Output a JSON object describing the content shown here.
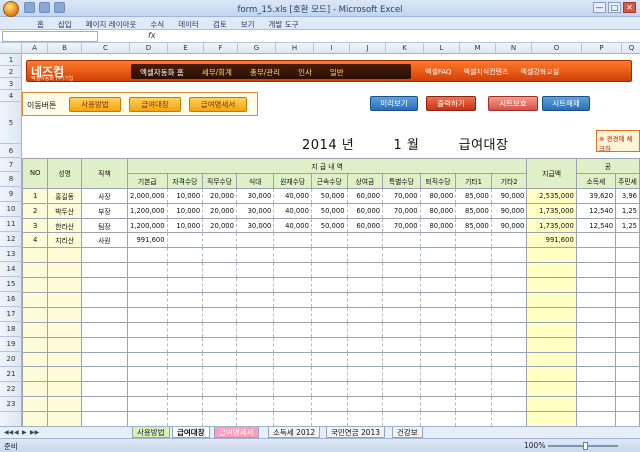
{
  "window": {
    "title": "form_15.xls [호환 모드] - Microsoft Excel",
    "controls": [
      "—",
      "□",
      "✕"
    ]
  },
  "ribbon": {
    "tabs": [
      "홈",
      "삽입",
      "페이지 레이아웃",
      "수식",
      "데이터",
      "검토",
      "보기",
      "개발 도구"
    ]
  },
  "formula_bar": {
    "fx": "fx",
    "name_box": "",
    "content": ""
  },
  "columns": [
    "A",
    "B",
    "C",
    "D",
    "E",
    "F",
    "G",
    "H",
    "I",
    "J",
    "K",
    "L",
    "M",
    "N",
    "O",
    "P",
    "Q"
  ],
  "rows": [
    "1",
    "2",
    "3",
    "4",
    "5",
    "6",
    "7",
    "8",
    "9",
    "10",
    "11",
    "12",
    "13",
    "14",
    "15",
    "16",
    "17",
    "18",
    "19",
    "20",
    "21",
    "22",
    "23",
    "24"
  ],
  "banner": {
    "logo": "네즈컴",
    "logo_sub": "엑셀자동화 (주)기업",
    "nav": [
      "엑셀자동화 홈",
      "세무/회계",
      "총무/관리",
      "인사",
      "일반"
    ],
    "links": [
      "엑셀FAQ",
      "엑셀지식컨텐츠",
      "엑셀강좌교실"
    ]
  },
  "toolbar": {
    "move_label": "이동버튼",
    "move_buttons": [
      "사용방법",
      "급여대장",
      "급여명세서"
    ],
    "buttons": [
      "미리보기",
      "출력하기",
      "시트보호",
      "시트해제"
    ]
  },
  "heading": {
    "year": "2014 년",
    "month": "1 월",
    "title": "급여대장"
  },
  "note": "※ 경경에 체크하",
  "table": {
    "group_header": "지 급 내 역",
    "right_group": "공",
    "headers": [
      "NO",
      "성명",
      "직책",
      "기본급",
      "자격수당",
      "직무수당",
      "식대",
      "원재수당",
      "근속수당",
      "상여금",
      "특별수당",
      "퇴직수당",
      "기타1",
      "기타2",
      "지급액",
      "소득세",
      "주민세"
    ],
    "rows": [
      {
        "no": "1",
        "name": "홍길동",
        "pos": "사장",
        "vals": [
          "2,000,000",
          "10,000",
          "20,000",
          "30,000",
          "40,000",
          "50,000",
          "60,000",
          "70,000",
          "80,000",
          "85,000",
          "90,000"
        ],
        "pay": "2,535,000",
        "tax": "39,620",
        "res": "3,96"
      },
      {
        "no": "2",
        "name": "박두산",
        "pos": "부장",
        "vals": [
          "1,200,000",
          "10,000",
          "20,000",
          "30,000",
          "40,000",
          "50,000",
          "60,000",
          "70,000",
          "80,000",
          "85,000",
          "90,000"
        ],
        "pay": "1,735,000",
        "tax": "12,540",
        "res": "1,25"
      },
      {
        "no": "3",
        "name": "한라산",
        "pos": "팀장",
        "vals": [
          "1,200,000",
          "10,000",
          "20,000",
          "30,000",
          "40,000",
          "50,000",
          "60,000",
          "70,000",
          "80,000",
          "85,000",
          "90,000"
        ],
        "pay": "1,735,000",
        "tax": "12,540",
        "res": "1,25"
      },
      {
        "no": "4",
        "name": "지리산",
        "pos": "사원",
        "vals": [
          "991,600",
          "",
          "",
          "",
          "",
          "",
          "",
          "",
          "",
          "",
          ""
        ],
        "pay": "991,600",
        "tax": "",
        "res": ""
      }
    ]
  },
  "sheet_tabs": [
    "사용방법",
    "급여대장",
    "급여명세서",
    "소득세 2012",
    "국민연금 2013",
    "건강보"
  ],
  "sheet_tab_nav": [
    "◀◀",
    "◀",
    "▶",
    "▶▶"
  ],
  "status": {
    "ready": "준비",
    "zoom": "100%"
  }
}
